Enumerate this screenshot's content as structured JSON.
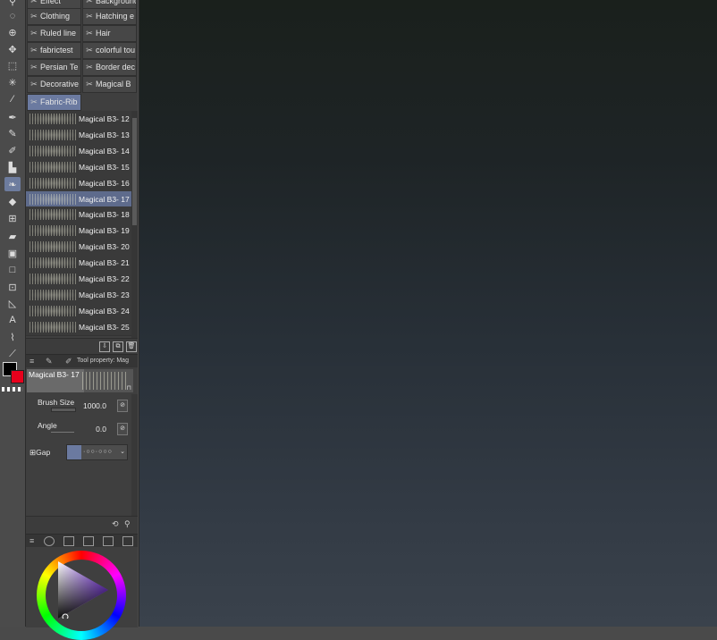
{
  "toolbar": {
    "tools": [
      {
        "icon": "zoom-icon",
        "glyph": "⚲"
      },
      {
        "icon": "lasso-rotate-icon",
        "glyph": "◌"
      },
      {
        "icon": "zoom-rotate-icon",
        "glyph": "⊕"
      },
      {
        "icon": "move-icon",
        "glyph": "✥"
      },
      {
        "icon": "rect-select-icon",
        "glyph": "⬚"
      },
      {
        "icon": "magic-wand-icon",
        "glyph": "✳"
      },
      {
        "icon": "eyedropper-icon",
        "glyph": "⁄"
      },
      {
        "icon": "pen-icon",
        "glyph": "✒"
      },
      {
        "icon": "pencil-icon",
        "glyph": "✎"
      },
      {
        "icon": "brush-icon",
        "glyph": "✐"
      },
      {
        "icon": "airbrush-icon",
        "glyph": "▙"
      },
      {
        "icon": "decoration-icon",
        "glyph": "❧"
      },
      {
        "icon": "eraser-icon",
        "glyph": "◆"
      },
      {
        "icon": "blend-icon",
        "glyph": "⊞"
      },
      {
        "icon": "fill-icon",
        "glyph": "▰"
      },
      {
        "icon": "gradient-icon",
        "glyph": "▣"
      },
      {
        "icon": "figure-icon",
        "glyph": "□"
      },
      {
        "icon": "frame-icon",
        "glyph": "⊡"
      },
      {
        "icon": "ruler-icon",
        "glyph": "◺"
      },
      {
        "icon": "text-icon",
        "glyph": "A"
      },
      {
        "icon": "balloon-icon",
        "glyph": "⌇"
      },
      {
        "icon": "correct-line-icon",
        "glyph": "⟋"
      }
    ],
    "main_color": "#000000",
    "sub_color": "#e8001c"
  },
  "subtool_groups": [
    {
      "label": "Effect",
      "icon": "effect-icon"
    },
    {
      "label": "Background",
      "icon": "background-icon"
    },
    {
      "label": "Clothing",
      "icon": "clothing-icon"
    },
    {
      "label": "Hatching e",
      "icon": "hatching-icon"
    },
    {
      "label": "Ruled line",
      "icon": "ruled-line-icon"
    },
    {
      "label": "Hair",
      "icon": "hair-icon"
    },
    {
      "label": "fabrictest",
      "icon": "fabric-icon"
    },
    {
      "label": "colorful tou",
      "icon": "colorful-icon"
    },
    {
      "label": "Persian Te",
      "icon": "persian-icon"
    },
    {
      "label": "Border dec",
      "icon": "border-icon"
    },
    {
      "label": "Decorative",
      "icon": "decorative-icon"
    },
    {
      "label": "Magical B",
      "icon": "magical-icon"
    },
    {
      "label": "Fabric-Rib",
      "icon": "fabric-rib-icon"
    }
  ],
  "brushes": [
    "Magical B3- 12",
    "Magical B3- 13",
    "Magical B3- 14",
    "Magical B3- 15",
    "Magical B3- 16",
    "Magical B3- 17",
    "Magical B3- 18",
    "Magical B3- 19",
    "Magical B3- 20",
    "Magical B3- 21",
    "Magical B3- 22",
    "Magical B3- 23",
    "Magical B3- 24",
    "Magical B3- 25"
  ],
  "selected_brush": "Magical B3- 17",
  "tool_property": {
    "title": "Tool property: Mag",
    "preview_name": "Magical B3- 17",
    "brush_size_label": "Brush Size",
    "brush_size_value": "1000.0",
    "angle_label": "Angle",
    "angle_value": "0.0",
    "gap_label": "Gap"
  }
}
